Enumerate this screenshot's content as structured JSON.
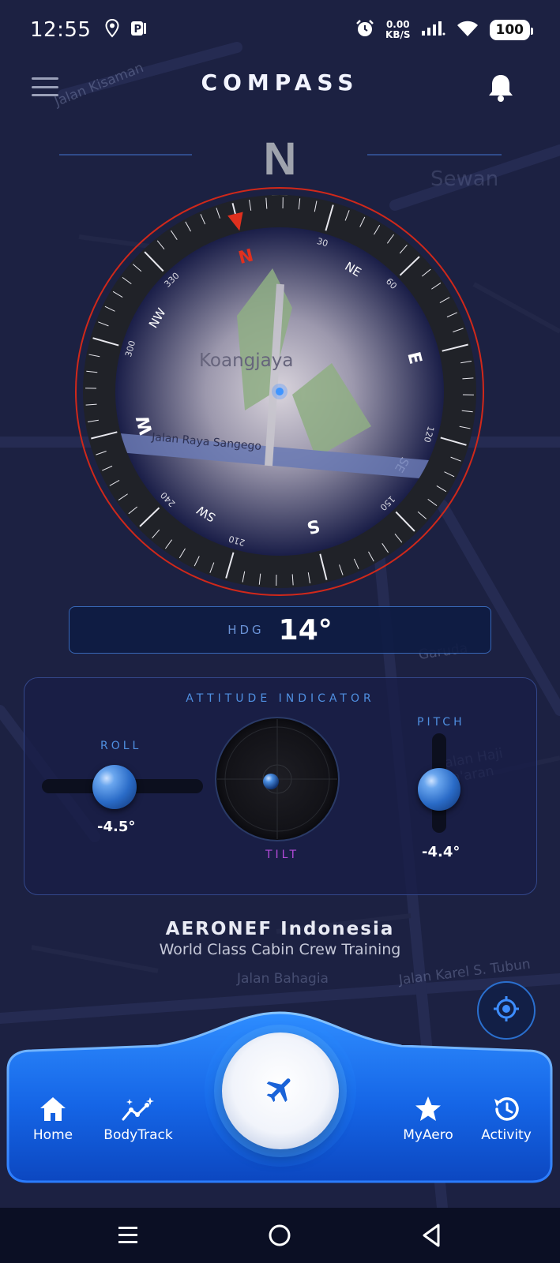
{
  "status_bar": {
    "time": "12:55",
    "net_speed_value": "0.00",
    "net_speed_unit": "KB/S",
    "battery": "100"
  },
  "header": {
    "title": "COMPASS"
  },
  "map_labels": {
    "place": "Koangjaya",
    "road": "Jalan Raya Sangego",
    "sewan": "Sewan",
    "garuda": "Garuda",
    "bahagia": "Jalan Bahagia",
    "karel": "Jalan Karel S. Tubun",
    "kisaman": "Jalan Kisaman",
    "haji": "Jalan Haji Sa'aran"
  },
  "compass": {
    "cardinal_north_big": "N",
    "heading_deg": 14,
    "cardinals": [
      "N",
      "NE",
      "E",
      "SE",
      "S",
      "SW",
      "W",
      "NW"
    ],
    "degree_labels": [
      "30",
      "60",
      "120",
      "150",
      "210",
      "240",
      "300",
      "330"
    ],
    "accent_color": "#e0301e"
  },
  "hdg": {
    "label": "HDG",
    "value": "14°"
  },
  "attitude": {
    "title": "ATTITUDE INDICATOR",
    "roll_label": "ROLL",
    "roll_value": "-4.5°",
    "pitch_label": "PITCH",
    "pitch_value": "-4.4°",
    "tilt_label": "TILT"
  },
  "brand": {
    "name": "AERONEF Indonesia",
    "tagline": "World Class Cabin Crew Training"
  },
  "bottom_nav": {
    "items": [
      {
        "label": "Home",
        "icon": "home-icon"
      },
      {
        "label": "BodyTrack",
        "icon": "sparkle-chart-icon"
      },
      {
        "label": "MyAero",
        "icon": "star-icon"
      },
      {
        "label": "Activity",
        "icon": "history-icon"
      }
    ],
    "center_icon": "airplane-icon",
    "accent": "#1f7bff"
  }
}
